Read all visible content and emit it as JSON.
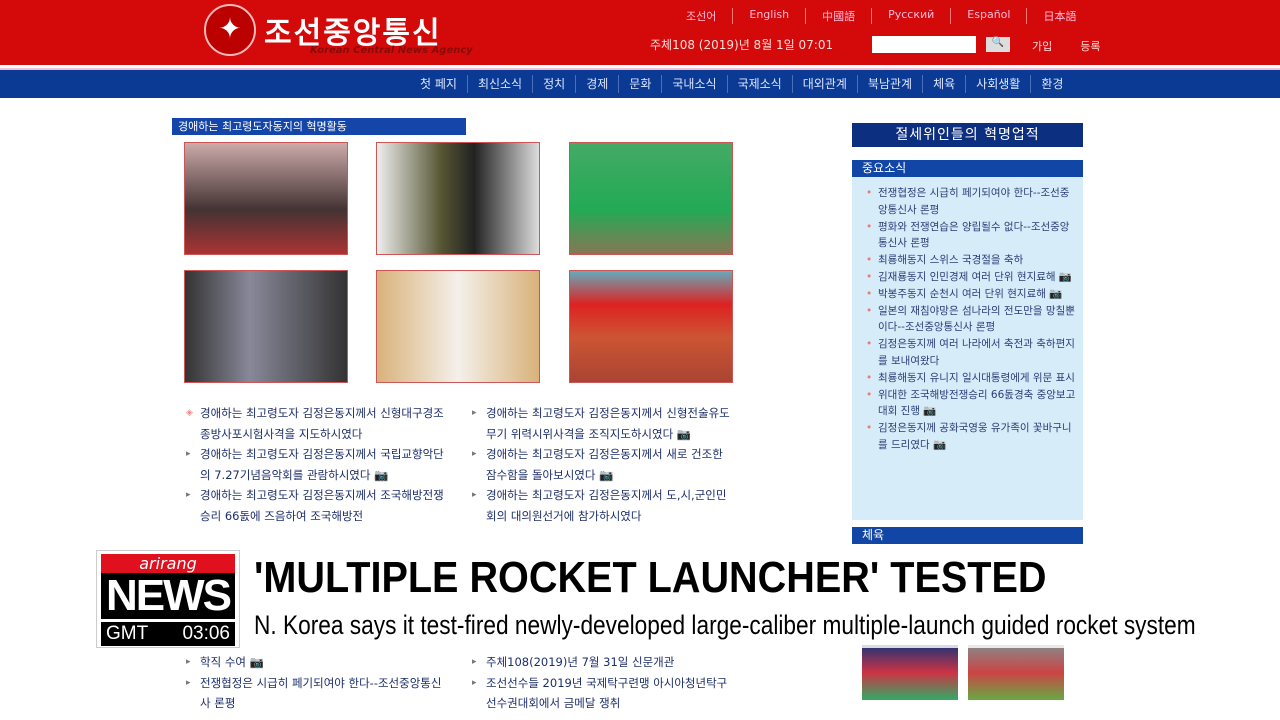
{
  "header": {
    "logo_ko": "조선중앙통신",
    "logo_en": "Korean Central News Agency",
    "languages": [
      "조선어",
      "English",
      "中國語",
      "Русский",
      "Español",
      "日本語"
    ],
    "date": "주체108 (2019)년 8월 1일 07:01",
    "search_placeholder": "",
    "search_icon": "magnifier-icon",
    "join": "가입",
    "login": "등록"
  },
  "nav": [
    "첫 페지",
    "최신소식",
    "정치",
    "경제",
    "문화",
    "국내소식",
    "국제소식",
    "대외관계",
    "북남관계",
    "체육",
    "사회생활",
    "환경"
  ],
  "main": {
    "section_title": "경애하는 최고령도자동지의 혁명활동",
    "news_left": [
      "경애하는 최고령도자 김정은동지께서 신형대구경조종방사포시험사격을 지도하시였다",
      "경애하는 최고령도자 김정은동지께서 국립교향악단의 7.27기념음악회를 관람하시였다 📷",
      "경애하는 최고령도자 김정은동지께서 조국해방전쟁승리 66돐에 즈음하여 조국해방전"
    ],
    "news_right": [
      "경애하는 최고령도자 김정은동지께서 신형전술유도무기 위력시위사격을 조직지도하시였다 📷",
      "경애하는 최고령도자 김정은동지께서 새로 건조한 잠수함을 돌아보시였다 📷",
      "경애하는 최고령도자 김정은동지께서 도,시,군인민회의 대의원선거에 참가하시였다"
    ],
    "news_left_bottom": [
      "학직 수여 📷",
      "전쟁협정은 시급히 페기되여야 한다--조선중앙통신사 론평"
    ],
    "news_right_bottom": [
      "주체108(2019)년 7월 31일 신문개관",
      "조선선수들 2019년 국제탁구련맹 아시아청년탁구선수권대회에서 금메달 쟁취"
    ]
  },
  "sidebar": {
    "title": "절세위인들의 혁명업적",
    "important_header": "중요소식",
    "items": [
      "전쟁협정은 시급히 페기되여야 한다--조선중앙통신사 론평",
      "평화와 전쟁연습은 양립될수 없다--조선중앙통신사 론평",
      "최룡해동지 스위스 국경절을 축하",
      "김재룡동지 인민경제 여러 단위 현지료해 📷",
      "박봉주동지 순천시 여러 단위 현지료해 📷",
      "일본의 재침야망은 섬나라의 전도만을 망칠뿐이다--조선중앙통신사 론평",
      "김정은동지께 여러 나라에서 축전과 축하편지를 보내여왔다",
      "최룡해동지 유니지 일시대통령에게 위문 표시",
      "위대한 조국해방전쟁승리 66돐경축 중앙보고대회 진행 📷",
      "김정은동지께 공화국영웅 유가족이 꽃바구니를 드리였다 📷"
    ],
    "sports_header": "체육"
  },
  "overlay": {
    "brand": "arirang",
    "news": "NEWS",
    "tz": "GMT",
    "time": "03:06",
    "headline": "'MULTIPLE ROCKET LAUNCHER' TESTED",
    "subtitle": "N. Korea says it test-fired newly-developed large-caliber multiple-launch guided rocket system"
  }
}
